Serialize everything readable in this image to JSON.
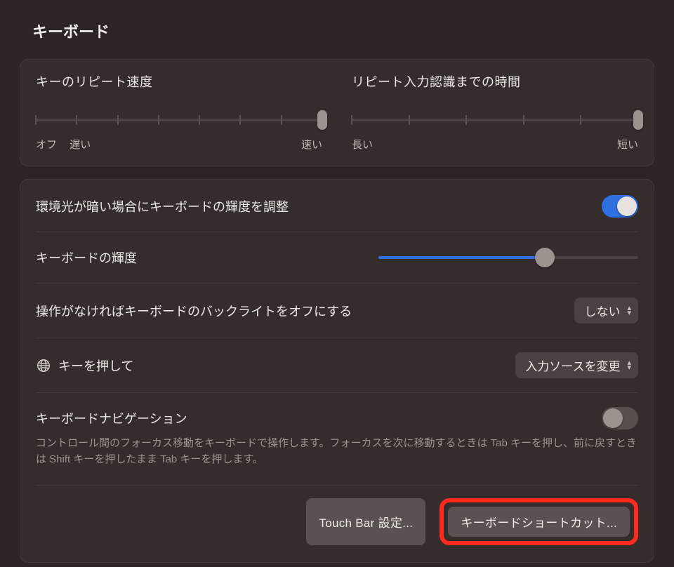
{
  "title": "キーボード",
  "repeat": {
    "title": "キーのリピート速度",
    "left1": "オフ",
    "left2": "遅い",
    "right": "速い",
    "ticks": 8,
    "value_index": 7
  },
  "delay": {
    "title": "リピート入力認識までの時間",
    "left": "長い",
    "right": "短い",
    "ticks": 6,
    "value_index": 5
  },
  "adjust_brightness": {
    "label": "環境光が暗い場合にキーボードの輝度を調整",
    "on": true
  },
  "brightness": {
    "label": "キーボードの輝度",
    "percent": 64
  },
  "backlight_off": {
    "label": "操作がなければキーボードのバックライトをオフにする",
    "value": "しない"
  },
  "globe_key": {
    "label": "キーを押して",
    "value": "入力ソースを変更"
  },
  "keyboard_nav": {
    "label": "キーボードナビゲーション",
    "desc": "コントロール間のフォーカス移動をキーボードで操作します。フォーカスを次に移動するときは Tab キーを押し、前に戻すときは Shift キーを押したまま Tab キーを押します。",
    "on": false
  },
  "buttons": {
    "touch_bar": "Touch Bar 設定...",
    "shortcuts": "キーボードショートカット..."
  }
}
